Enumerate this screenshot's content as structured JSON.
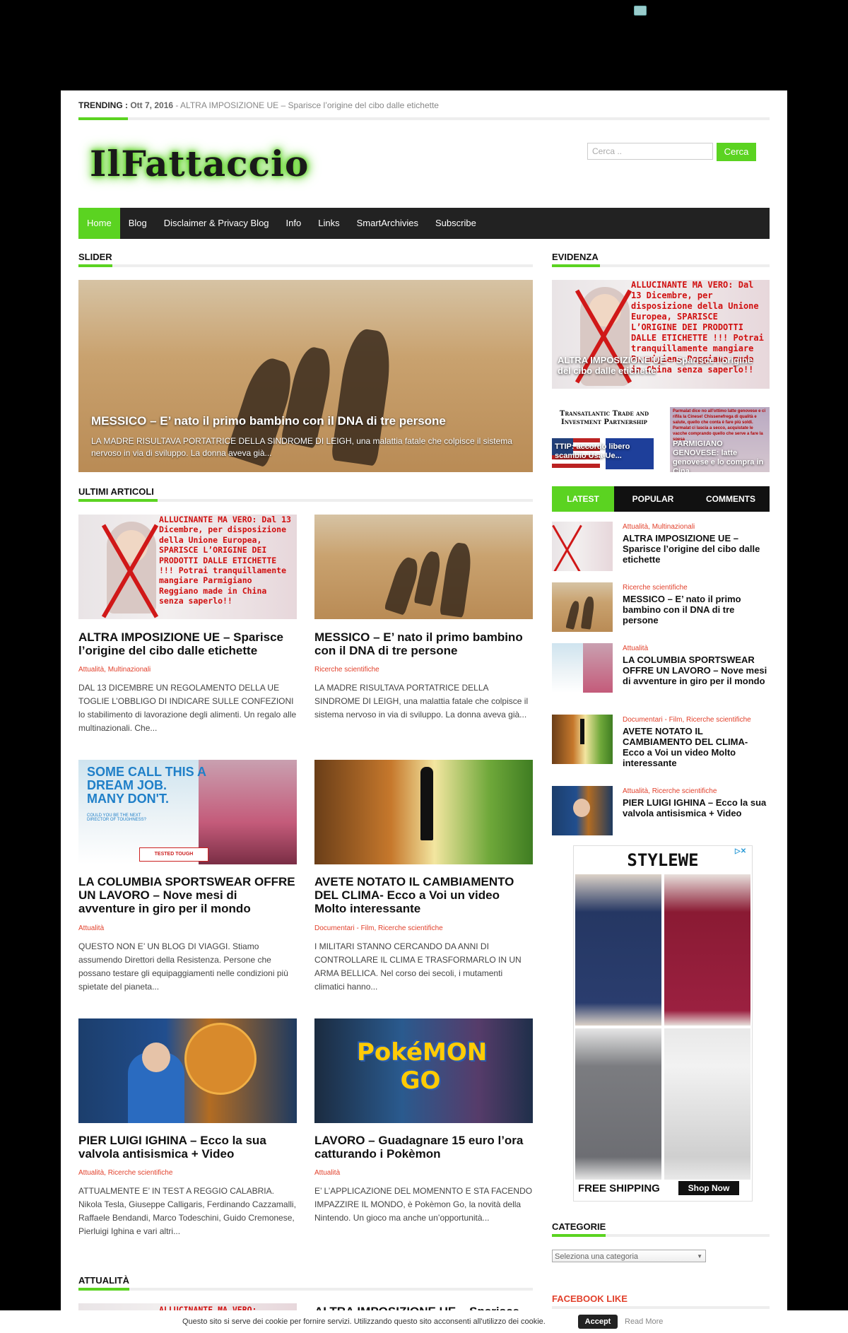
{
  "trending": {
    "label": "TRENDING :",
    "date": "Ott 7, 2016",
    "text": " - ALTRA IMPOSIZIONE UE – Sparisce l’origine del cibo dalle etichette"
  },
  "logo": "IlFattaccio",
  "search": {
    "placeholder": "Cerca ..",
    "button": "Cerca"
  },
  "nav": [
    "Home",
    "Blog",
    "Disclaimer & Privacy Blog",
    "Info",
    "Links",
    "SmartArchivies",
    "Subscribe"
  ],
  "slider": {
    "heading": "SLIDER",
    "title": "MESSICO – E’ nato il primo bambino con il DNA di tre persone",
    "excerpt": "LA MADRE RISULTAVA PORTATRICE DELLA SINDROME DI LEIGH, una malattia fatale che colpisce il sistema nervoso in via di sviluppo. La donna aveva già..."
  },
  "evidenza": {
    "heading": "EVIDENZA",
    "main_title": "ALTRA IMPOSIZIONE UE – Sparisce l’origine del cibo dalle etichette",
    "ue_image_text": "ALLUCINANTE MA VERO: Dal 13 Dicembre, per disposizione della Unione Europea, SPARISCE L’ORIGINE DEI PRODOTTI DALLE ETICHETTE !!! Potrai tranquillamente mangiare Parmigiano Reggiano made in China senza saperlo!!",
    "ttip_image_text": "Transatlantic Trade and Investment Partnership",
    "thumb1_caption": "TTIP: accordo libero scambio Usa-Ue...",
    "thumb2_caption": "PARMIGIANO GENOVESE: latte genovese e lo compra in Cina",
    "parma_image_text": "Parmalat dice no all'ottimo latte genovese e ci rifila la Cinese! Chissenefrega di qualità e salute, quello che conta è fare più soldi. Parmalat ci lascia a secco, acquistate le vacche comprando quello che serve a fare la spesa"
  },
  "ultimi": {
    "heading": "ULTIMI ARTICOLI",
    "articles": [
      {
        "title": "ALTRA IMPOSIZIONE UE – Sparisce l’origine del cibo dalle etichette",
        "cats": "Attualità, Multinazionali",
        "excerpt": "DAL 13 DICEMBRE UN REGOLAMENTO DELLA UE TOGLIE L’OBBLIGO DI INDICARE SULLE CONFEZIONI lo stabilimento di lavorazione degli alimenti. Un regalo alle multinazionali. Che..."
      },
      {
        "title": "MESSICO – E’ nato il primo bambino con il DNA di tre persone",
        "cats": "Ricerche scientifiche",
        "excerpt": "LA MADRE RISULTAVA PORTATRICE DELLA SINDROME DI LEIGH, una malattia fatale che colpisce il sistema nervoso in via di sviluppo. La donna aveva già..."
      },
      {
        "title": "LA COLUMBIA SPORTSWEAR OFFRE UN LAVORO – Nove mesi di avventure in giro per il mondo",
        "cats": "Attualità",
        "excerpt": "QUESTO NON E’ UN BLOG DI VIAGGI. Stiamo assumendo Direttori della Resistenza. Persone che possano testare gli equipaggiamenti nelle condizioni più spietate del pianeta..."
      },
      {
        "title": "AVETE NOTATO IL CAMBIAMENTO DEL CLIMA- Ecco a Voi un video Molto interessante",
        "cats": "Documentari - Film, Ricerche scientifiche",
        "excerpt": "I MILITARI STANNO CERCANDO DA ANNI DI CONTROLLARE IL CLIMA E TRASFORMARLO IN UN ARMA BELLICA. Nel corso dei secoli, i mutamenti climatici hanno..."
      },
      {
        "title": "PIER LUIGI IGHINA – Ecco la sua valvola antisismica + Video",
        "cats": "Attualità, Ricerche scientifiche",
        "excerpt": "ATTUALMENTE E’ IN TEST A REGGIO CALABRIA. Nikola Tesla, Giuseppe Calligaris, Ferdinando Cazzamalli, Raffaele Bendandi, Marco Todeschini, Guido Cremonese, Pierluigi Ighina e vari altri..."
      },
      {
        "title": "LAVORO – Guadagnare 15 euro l’ora catturando i Pokèmon",
        "cats": "Attualità",
        "excerpt": "E’ L’APPLICAZIONE DEL MOMENNTO E STA FACENDO IMPAZZIRE IL MONDO, è Pokèmon Go, la novità della Nintendo. Un gioco ma anche un’opportunità..."
      }
    ],
    "columbia_image_text": "SOME CALL THIS A DREAM JOB. MANY DON'T.",
    "columbia_small_text": "COULD YOU BE THE NEXT DIRECTOR OF TOUGHNESS?",
    "columbia_tag": "TESTED TOUGH",
    "poke_text": "PokéMON GO"
  },
  "attualita": {
    "heading": "ATTUALITÀ",
    "peek_title": "ALTRA IMPOSIZIONE UE – Sparisce"
  },
  "tabs": {
    "latest": "LATEST",
    "popular": "POPULAR",
    "comments": "COMMENTS"
  },
  "latest": [
    {
      "cats": "Attualità, Multinazionali",
      "title": "ALTRA IMPOSIZIONE UE – Sparisce l’origine del cibo dalle etichette"
    },
    {
      "cats": "Ricerche scientifiche",
      "title": "MESSICO – E’ nato il primo bambino con il DNA di tre persone"
    },
    {
      "cats": "Attualità",
      "title": "LA COLUMBIA SPORTSWEAR OFFRE UN LAVORO – Nove mesi di avventure in giro per il mondo"
    },
    {
      "cats": "Documentari - Film, Ricerche scientifiche",
      "title": "AVETE NOTATO IL CAMBIAMENTO DEL CLIMA- Ecco a Voi un video Molto interessante"
    },
    {
      "cats": "Attualità, Ricerche scientifiche",
      "title": "PIER LUIGI IGHINA – Ecco la sua valvola antisismica + Video"
    }
  ],
  "ad": {
    "brand": "STYLEWE",
    "shipping": "FREE SHIPPING",
    "cta": "Shop Now"
  },
  "categorie": {
    "heading": "CATEGORIE",
    "select": "Seleziona una categoria"
  },
  "facebook": {
    "heading": "FACEBOOK LIKE"
  },
  "cookie": {
    "message": "Questo sito si serve dei cookie per fornire servizi. Utilizzando questo sito acconsenti all'utilizzo dei cookie.",
    "accept": "Accept",
    "more": "Read More"
  },
  "colors": {
    "accent": "#5bd321",
    "category": "#e2412c",
    "nav": "#222222"
  }
}
